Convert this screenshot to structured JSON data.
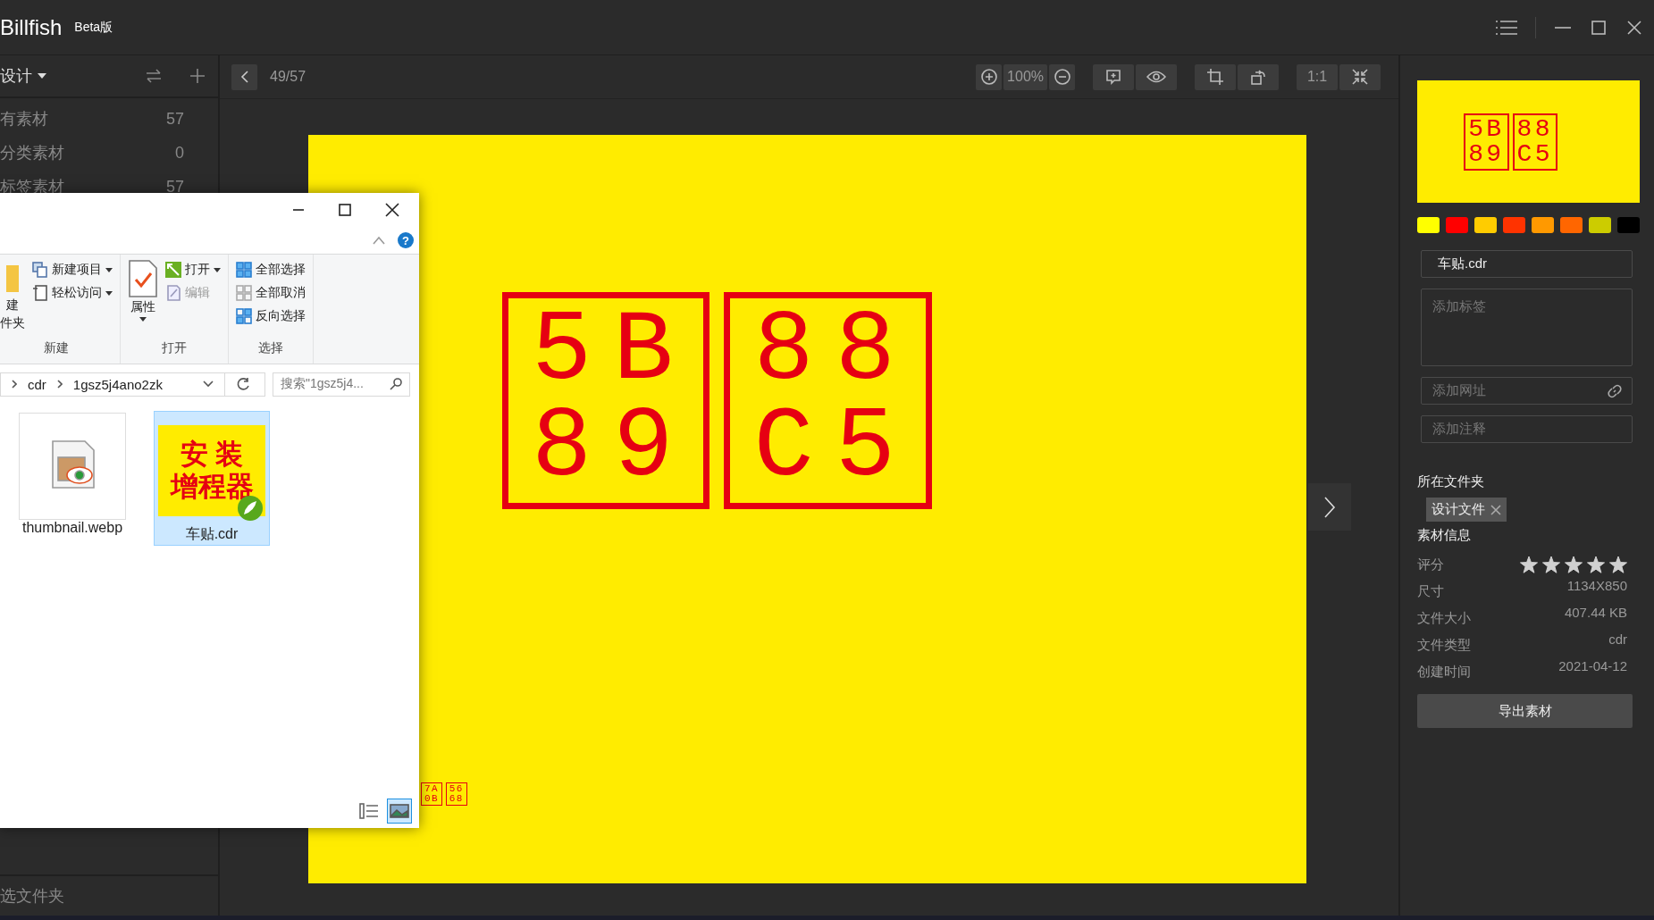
{
  "app": {
    "title": "Billfish",
    "badge": "Beta版"
  },
  "sidebar": {
    "library": "设计",
    "items": [
      {
        "label": "有素材",
        "count": "57",
        "selected": false
      },
      {
        "label": "分类素材",
        "count": "0",
        "selected": false
      },
      {
        "label": "标签素材",
        "count": "57",
        "selected": false
      }
    ],
    "footer": "选文件夹"
  },
  "toolbar": {
    "position": "49/57",
    "zoom": "100%",
    "actual_size": "1:1"
  },
  "preview": {
    "glyph_boxes": [
      [
        "5B",
        "89"
      ],
      [
        "88",
        "C5"
      ]
    ],
    "small_glyph_boxes": [
      [
        "7A",
        "0B"
      ],
      [
        "56",
        "68"
      ]
    ]
  },
  "explorer": {
    "ribbon": [
      {
        "name": "新建",
        "items": [
          {
            "kind": "large",
            "lines": [
              "建",
              "件夹"
            ],
            "dropdown": false,
            "disabled": false
          },
          {
            "kind": "small",
            "label": "新建项目",
            "dropdown": true,
            "disabled": false
          },
          {
            "kind": "small",
            "label": "轻松访问",
            "dropdown": true,
            "disabled": false
          }
        ]
      },
      {
        "name": "打开",
        "items": [
          {
            "kind": "large",
            "label": "属性",
            "dropdown": true,
            "disabled": false
          },
          {
            "kind": "small",
            "label": "打开",
            "dropdown": true,
            "disabled": false
          },
          {
            "kind": "small",
            "label": "编辑",
            "dropdown": false,
            "disabled": true
          }
        ]
      },
      {
        "name": "选择",
        "items": [
          {
            "kind": "small",
            "label": "全部选择",
            "dropdown": false,
            "disabled": false
          },
          {
            "kind": "small",
            "label": "全部取消",
            "dropdown": false,
            "disabled": false
          },
          {
            "kind": "small",
            "label": "反向选择",
            "dropdown": false,
            "disabled": false
          }
        ]
      }
    ],
    "help": "?",
    "path": [
      "cdr",
      "1gsz5j4ano2zk"
    ],
    "search": {
      "placeholder": "搜索\"1gsz5j4..."
    },
    "files": [
      {
        "kind": "webp",
        "name": "thumbnail.webp",
        "selected": false
      },
      {
        "kind": "cdr",
        "name": "车贴.cdr",
        "selected": true,
        "thumbnail_lines": [
          "安 装",
          "增程器"
        ]
      }
    ],
    "view_buttons": [
      {
        "kind": "details",
        "selected": false
      },
      {
        "kind": "thumbnails",
        "selected": true
      }
    ]
  },
  "inspector": {
    "thumbnail_glyph_boxes": [
      [
        "5B",
        "89"
      ],
      [
        "88",
        "C5"
      ]
    ],
    "swatches": [
      {
        "color": "#ffff00"
      },
      {
        "color": "#ff0000"
      },
      {
        "color": "#ffcc00"
      },
      {
        "color": "#ff3300"
      },
      {
        "color": "#ff9900"
      },
      {
        "color": "#ff6600"
      },
      {
        "color": "#cccc00"
      },
      {
        "color": "#000000"
      }
    ],
    "name": "车贴.cdr",
    "tags_placeholder": "添加标签",
    "url_placeholder": "添加网址",
    "note_placeholder": "添加注释",
    "folder_heading": "所在文件夹",
    "folders": [
      "设计文件"
    ],
    "info_heading": "素材信息",
    "rating_label": "评分",
    "stars": 5,
    "fields": [
      {
        "label": "尺寸",
        "value": "1134X850"
      },
      {
        "label": "文件大小",
        "value": "407.44 KB"
      },
      {
        "label": "文件类型",
        "value": "cdr"
      },
      {
        "label": "创建时间",
        "value": "2021-04-12"
      }
    ],
    "export_button": "导出素材"
  }
}
